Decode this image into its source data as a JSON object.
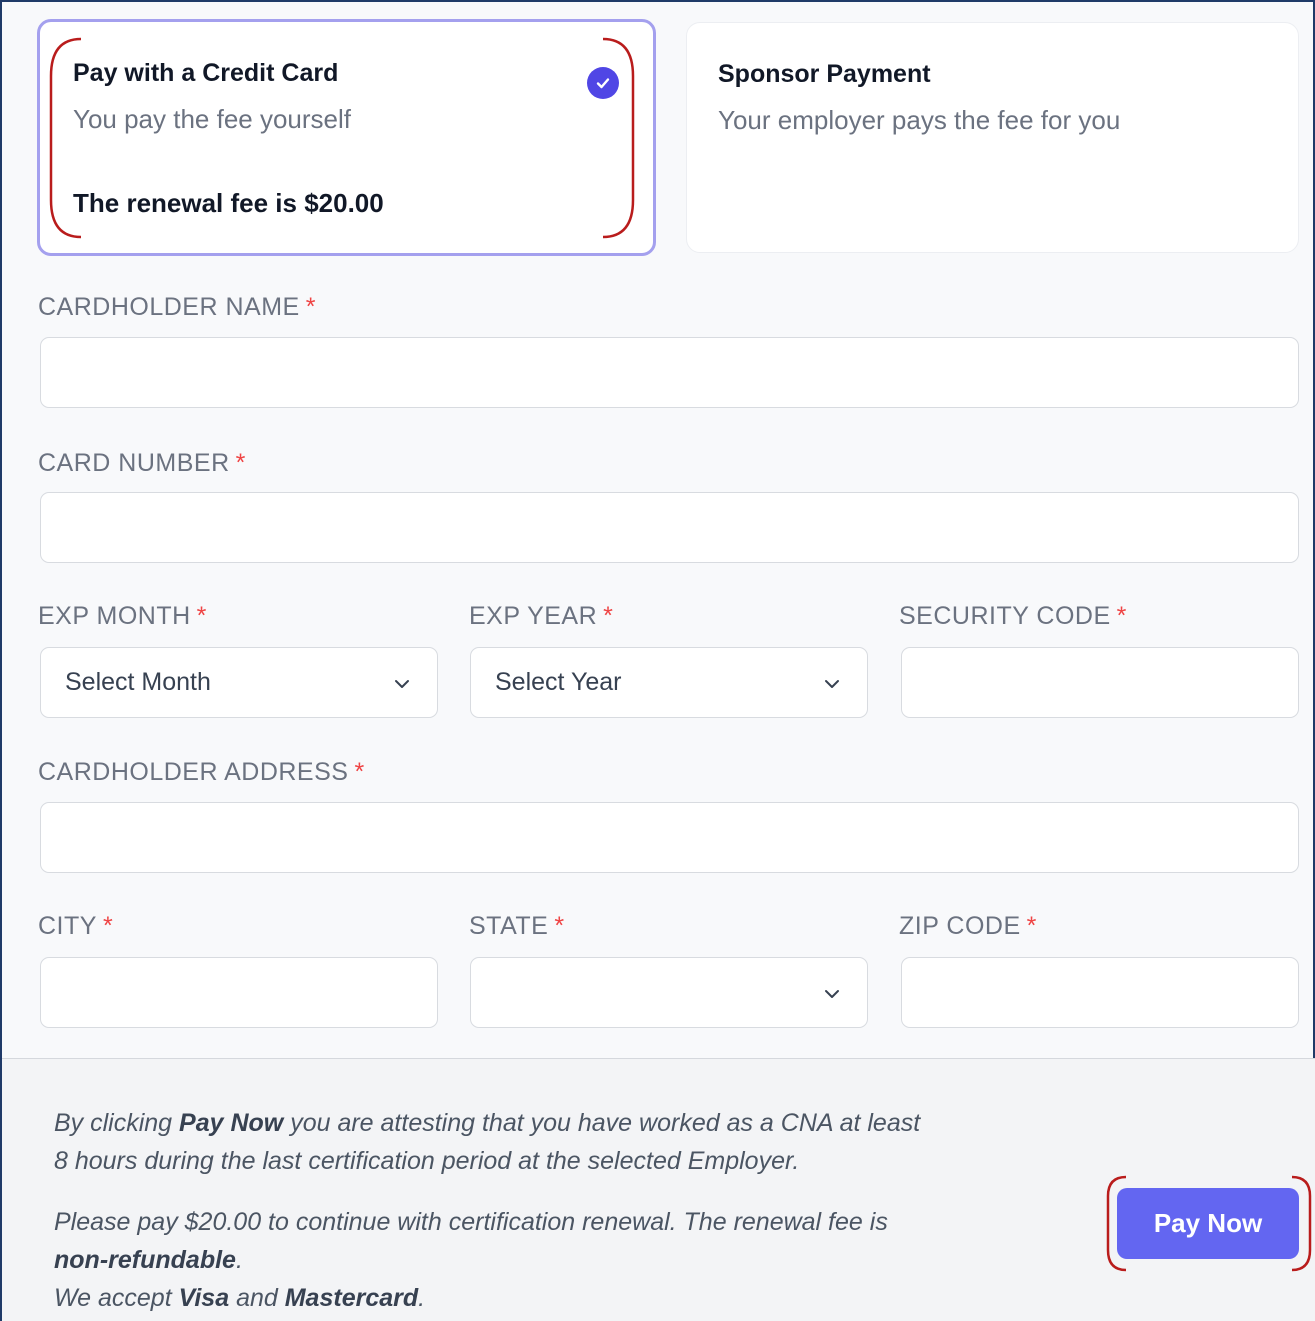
{
  "payment_options": {
    "credit_card": {
      "title": "Pay with a Credit Card",
      "subtitle": "You pay the fee yourself",
      "fee_text": "The renewal fee is $20.00",
      "selected": true
    },
    "sponsor": {
      "title": "Sponsor Payment",
      "subtitle": "Your employer pays the fee for you",
      "selected": false
    }
  },
  "form": {
    "required_marker": "*",
    "cardholder_name": {
      "label": "CARDHOLDER NAME",
      "value": ""
    },
    "card_number": {
      "label": "CARD NUMBER",
      "value": ""
    },
    "exp_month": {
      "label": "EXP MONTH",
      "selected": "Select Month"
    },
    "exp_year": {
      "label": "EXP YEAR",
      "selected": "Select Year"
    },
    "security_code": {
      "label": "SECURITY CODE",
      "value": ""
    },
    "cardholder_address": {
      "label": "CARDHOLDER ADDRESS",
      "value": ""
    },
    "city": {
      "label": "CITY",
      "value": ""
    },
    "state": {
      "label": "STATE",
      "selected": ""
    },
    "zip_code": {
      "label": "ZIP CODE",
      "value": ""
    }
  },
  "footer": {
    "attest_prefix": "By clicking ",
    "attest_bold": "Pay Now",
    "attest_line1_rest": " you are attesting that you have worked as a CNA at least",
    "attest_line2": "8 hours during the last certification period at the selected Employer.",
    "pay_line1": "Please pay $20.00 to continue with certification renewal. The renewal fee is",
    "pay_line2_bold": "non-refundable",
    "pay_line2_rest": ".",
    "accept_prefix": "We accept ",
    "accept_visa": "Visa",
    "accept_and": " and ",
    "accept_mc": "Mastercard",
    "accept_end": "."
  },
  "pay_button": {
    "label": "Pay Now"
  },
  "colors": {
    "accent": "#6366f1",
    "check": "#5046e5",
    "selected_border": "#a4a0ee",
    "required": "#ef4444",
    "annotation": "#b91c1c"
  }
}
